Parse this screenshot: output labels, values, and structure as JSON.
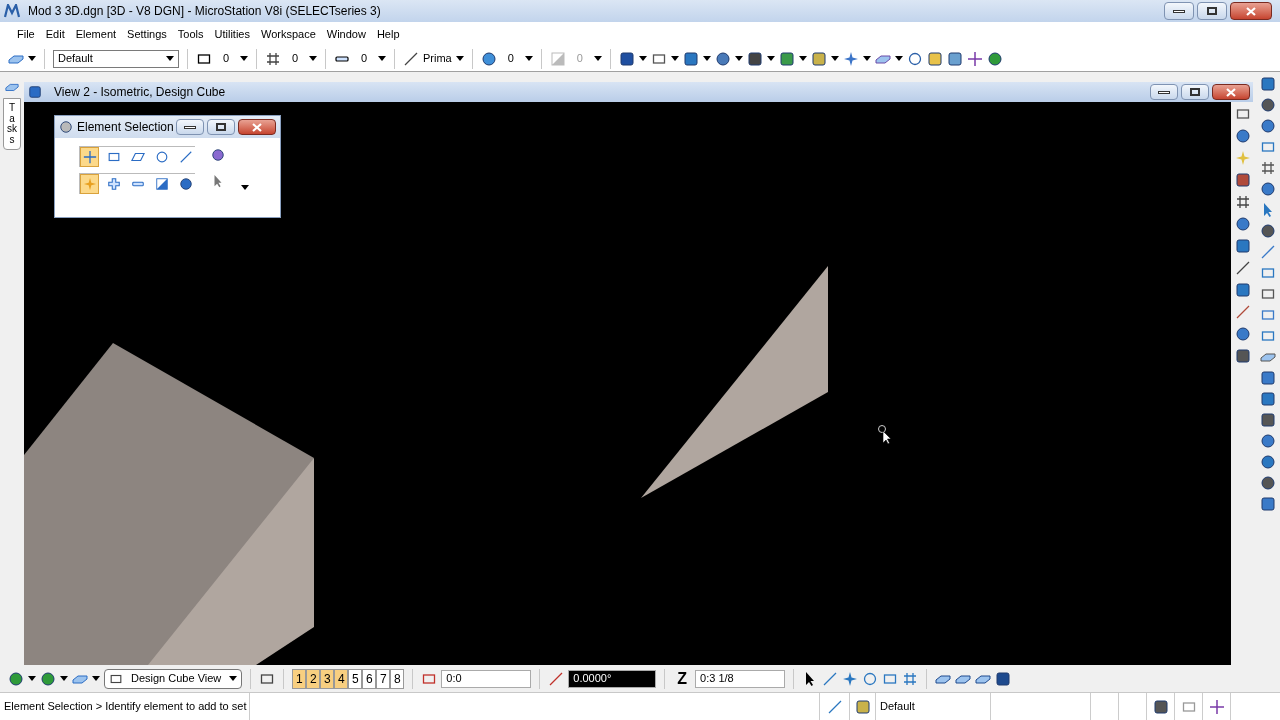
{
  "window": {
    "title": "Mod 3 3D.dgn [3D - V8 DGN] - MicroStation V8i (SELECTseries 3)"
  },
  "menu": [
    "File",
    "Edit",
    "Element",
    "Settings",
    "Tools",
    "Utilities",
    "Workspace",
    "Window",
    "Help"
  ],
  "attributes": {
    "level": "Default",
    "color_index": "0",
    "style": "0",
    "weight": "0",
    "class": "Prima",
    "transparency": "0",
    "priority": "0",
    "priority_disabled": true
  },
  "tasks_tab": "Tasks",
  "view": {
    "title": "View 2 - Isometric, Design Cube"
  },
  "element_selection": {
    "title": "Element Selection",
    "methods": [
      {
        "kind": "individual",
        "selected": true
      },
      {
        "kind": "block",
        "selected": false
      },
      {
        "kind": "shape",
        "selected": false
      },
      {
        "kind": "circle",
        "selected": false
      },
      {
        "kind": "line",
        "selected": false
      }
    ],
    "modes": [
      {
        "kind": "new",
        "selected": true
      },
      {
        "kind": "add",
        "selected": false
      },
      {
        "kind": "subtract",
        "selected": false
      },
      {
        "kind": "invert",
        "selected": false
      },
      {
        "kind": "all",
        "selected": false
      }
    ]
  },
  "bottom_toolbar": {
    "saved_view": "Design Cube View",
    "views": [
      {
        "label": "1",
        "selected": true
      },
      {
        "label": "2",
        "selected": true
      },
      {
        "label": "3",
        "selected": true
      },
      {
        "label": "4",
        "selected": true
      },
      {
        "label": "5",
        "selected": false
      },
      {
        "label": "6",
        "selected": false
      },
      {
        "label": "7",
        "selected": false
      },
      {
        "label": "8",
        "selected": false
      }
    ],
    "position": "0:0",
    "angle": "0.0000°",
    "z_label": "Z",
    "depth": "0:3 1/8"
  },
  "status_bar": {
    "prompt": "Element Selection > Identify element to add to set",
    "level": "Default"
  }
}
